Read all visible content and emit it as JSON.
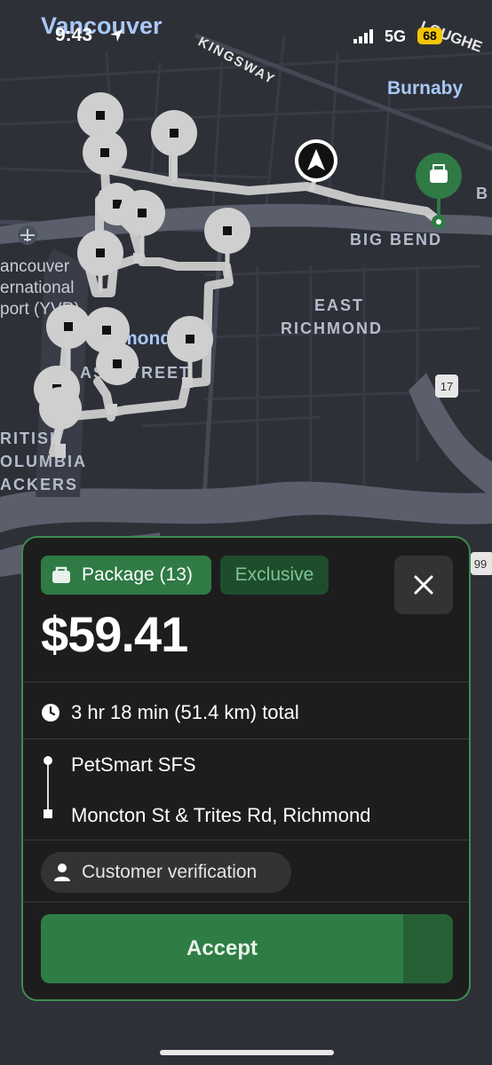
{
  "status_bar": {
    "time": "9:43",
    "network": "5G",
    "battery": "68",
    "icons": [
      "location-arrow-icon",
      "signal-bars-icon"
    ]
  },
  "map": {
    "labels": {
      "vancouver": "Vancouver",
      "kingsway": "KINGSWAY",
      "lougheed": "LOUGHE",
      "burnaby": "Burnaby",
      "big_bend": "BIG BEND",
      "east_richmond_1": "EAST",
      "east_richmond_2": "RICHMOND",
      "airport_1": "ancouver",
      "airport_2": "ernational",
      "airport_3": "port (YVR)",
      "richmond": "mond",
      "street": "ASTSTREET",
      "bc_1": "RITISH",
      "bc_2": "OLUMBIA",
      "bc_3": "ACKERS",
      "edge_b": "B",
      "hwy_17": "17",
      "hwy_99": "99"
    },
    "colors": {
      "land": "#2e3038",
      "water": "#5b5e6b",
      "route": "#d6d6d6",
      "pin": "#cfcfcf",
      "destination": "#2f7a45"
    },
    "icons": [
      "navigation-arrow-icon",
      "destination-bag-icon",
      "airport-icon"
    ]
  },
  "card": {
    "package_label": "Package (13)",
    "exclusive_label": "Exclusive",
    "price": "$59.41",
    "duration": "3 hr 18 min (51.4 km) total",
    "pickup": "PetSmart SFS",
    "dropoff": "Moncton St & Trites Rd, Richmond",
    "verification": "Customer verification",
    "accept_label": "Accept",
    "accent": "#2e7d45",
    "icons": [
      "bag-icon",
      "close-icon",
      "clock-icon",
      "person-icon"
    ]
  }
}
